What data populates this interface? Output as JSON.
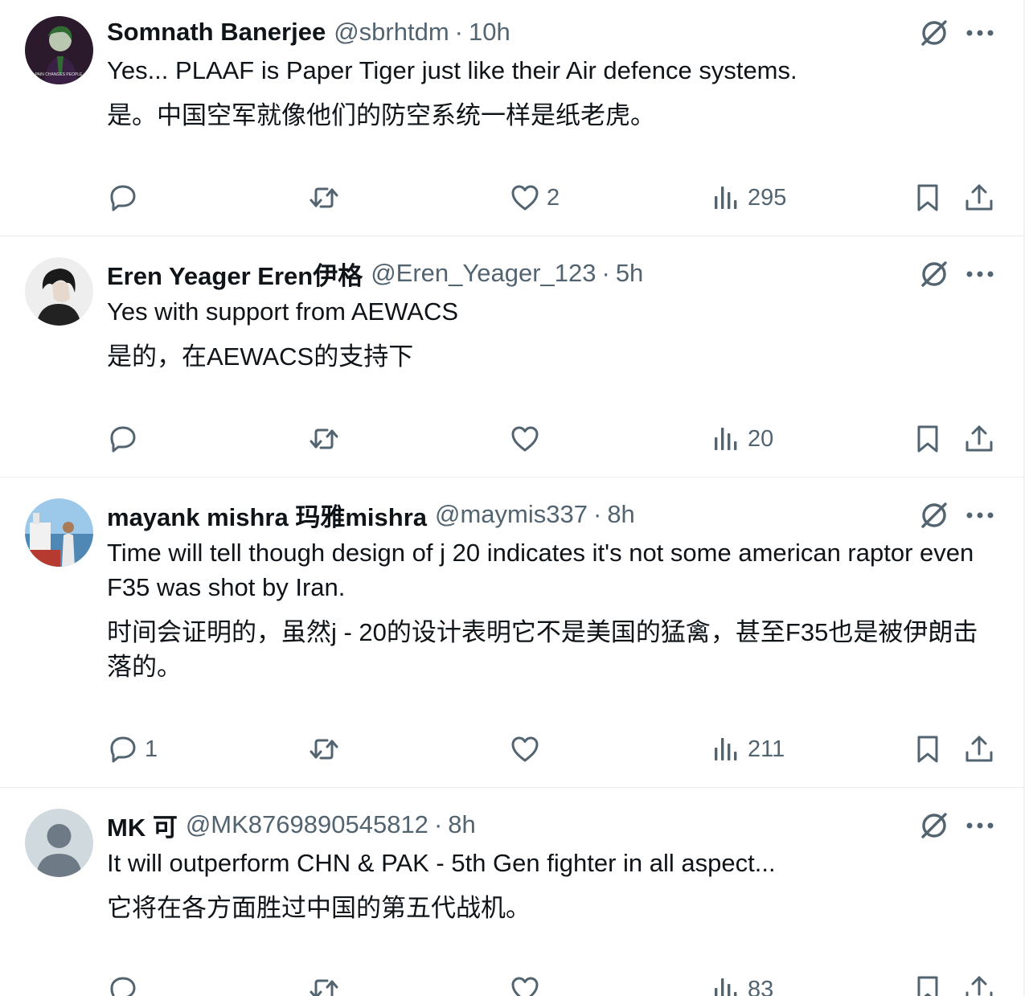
{
  "colors": {
    "text": "#0f1419",
    "secondary": "#536471",
    "divider": "#e6ecf0"
  },
  "separator": "·",
  "tweets": [
    {
      "name": "Somnath Banerjee",
      "handle": "@sbrhtdm",
      "time": "10h",
      "text": "Yes... PLAAF is Paper Tiger just like their Air defence systems.",
      "translation": "是。中国空军就像他们的防空系统一样是纸老虎。",
      "avatar_text": "PAIN CHANGES PEOPLE",
      "stats": {
        "replies": "",
        "reposts": "",
        "likes": "2",
        "views": "295"
      }
    },
    {
      "name": "Eren Yeager Eren伊格",
      "handle": "@Eren_Yeager_123",
      "time": "5h",
      "text": "Yes with support from AEWACS",
      "translation": "是的，在AEWACS的支持下",
      "stats": {
        "replies": "",
        "reposts": "",
        "likes": "",
        "views": "20"
      }
    },
    {
      "name": "mayank mishra 玛雅mishra",
      "handle": "@maymis337",
      "time": "8h",
      "text": "Time will tell though design of j 20 indicates it's not some american raptor even F35 was shot by Iran.",
      "translation": "时间会证明的，虽然j - 20的设计表明它不是美国的猛禽，甚至F35也是被伊朗击落的。",
      "stats": {
        "replies": "1",
        "reposts": "",
        "likes": "",
        "views": "211"
      }
    },
    {
      "name": "MK 可",
      "handle": "@MK8769890545812",
      "time": "8h",
      "text": "It will outperform CHN & PAK - 5th Gen fighter in all aspect...",
      "translation": "它将在各方面胜过中国的第五代战机。",
      "stats": {
        "replies": "",
        "reposts": "",
        "likes": "",
        "views": "83"
      }
    }
  ]
}
